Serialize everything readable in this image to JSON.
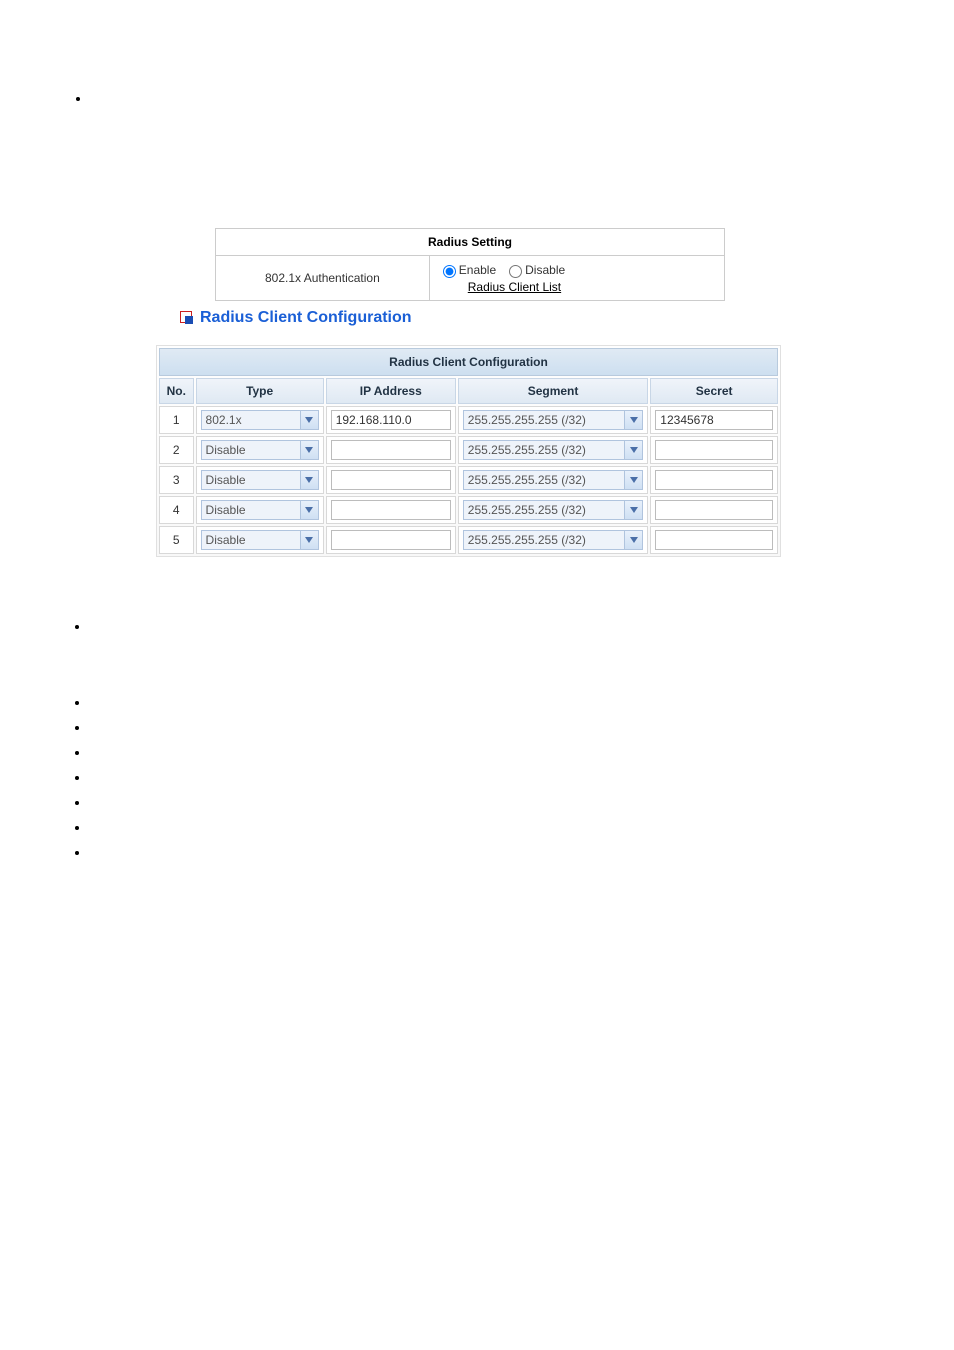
{
  "radiusSetting": {
    "title": "Radius Setting",
    "authLabel": "802.1x Authentication",
    "enableLabel": "Enable",
    "disableLabel": "Disable",
    "linkLabel": "Radius Client List"
  },
  "sectionTitle": "Radius Client Configuration",
  "config": {
    "title": "Radius Client Configuration",
    "cols": {
      "no": "No.",
      "type": "Type",
      "ip": "IP Address",
      "segment": "Segment",
      "secret": "Secret"
    },
    "rows": [
      {
        "no": "1",
        "type": "802.1x",
        "ip": "192.168.110.0",
        "segment": "255.255.255.255 (/32)",
        "secret": "12345678"
      },
      {
        "no": "2",
        "type": "Disable",
        "ip": "",
        "segment": "255.255.255.255 (/32)",
        "secret": ""
      },
      {
        "no": "3",
        "type": "Disable",
        "ip": "",
        "segment": "255.255.255.255 (/32)",
        "secret": ""
      },
      {
        "no": "4",
        "type": "Disable",
        "ip": "",
        "segment": "255.255.255.255 (/32)",
        "secret": ""
      },
      {
        "no": "5",
        "type": "Disable",
        "ip": "",
        "segment": "255.255.255.255 (/32)",
        "secret": ""
      }
    ]
  }
}
